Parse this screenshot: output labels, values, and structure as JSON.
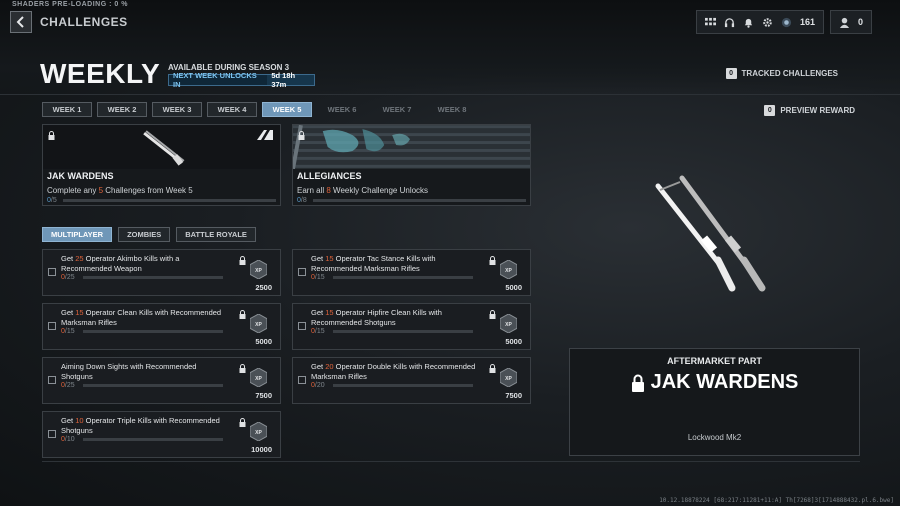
{
  "system": {
    "shaders": "SHADERS PRE-LOADING : 0 %",
    "build": "10.12.18878224 [68:217:11281+11:A] Th[7268]3[1714888432.pl.6.bwe]"
  },
  "header": {
    "breadcrumb": "CHALLENGES",
    "cod_points": "161",
    "tokens": "0"
  },
  "page": {
    "title": "WEEKLY",
    "availability": "AVAILABLE DURING SEASON 3",
    "next_week_label": "NEXT WEEK UNLOCKS IN",
    "next_week_time": "5d 18h 37m",
    "tracked_key": "0",
    "tracked_label": "TRACKED CHALLENGES",
    "preview_key": "0",
    "preview_label": "PREVIEW REWARD"
  },
  "weeks": [
    {
      "label": "WEEK 1",
      "state": "normal"
    },
    {
      "label": "WEEK 2",
      "state": "normal"
    },
    {
      "label": "WEEK 3",
      "state": "normal"
    },
    {
      "label": "WEEK 4",
      "state": "normal"
    },
    {
      "label": "WEEK 5",
      "state": "active"
    },
    {
      "label": "WEEK 6",
      "state": "locked"
    },
    {
      "label": "WEEK 7",
      "state": "locked"
    },
    {
      "label": "WEEK 8",
      "state": "locked"
    }
  ],
  "rewards": [
    {
      "name": "JAK WARDENS",
      "desc_pre": "Complete any ",
      "desc_num": "5",
      "desc_post": " Challenges from Week 5",
      "progress": "0",
      "total": "/5",
      "brand": "A"
    },
    {
      "name": "ALLEGIANCES",
      "desc_pre": "Earn all ",
      "desc_num": "8",
      "desc_post": " Weekly Challenge Unlocks",
      "progress": "0",
      "total": "/8"
    }
  ],
  "modes": [
    {
      "label": "MULTIPLAYER",
      "active": true
    },
    {
      "label": "ZOMBIES",
      "active": false
    },
    {
      "label": "BATTLE ROYALE",
      "active": false
    }
  ],
  "challenges": [
    {
      "pre": "Get ",
      "num": "25",
      "post": " Operator Akimbo Kills with a Recommended Weapon",
      "progress": "0",
      "total": "/25",
      "xp": "2500"
    },
    {
      "pre": "Get ",
      "num": "15",
      "post": " Operator Tac Stance Kills with Recommended Marksman Rifles",
      "progress": "0",
      "total": "/15",
      "xp": "5000"
    },
    {
      "pre": "Get ",
      "num": "15",
      "post": " Operator Clean Kills with Recommended Marksman Rifles",
      "progress": "0",
      "total": "/15",
      "xp": "5000"
    },
    {
      "pre": "Get ",
      "num": "15",
      "post": " Operator Hipfire Clean Kills with Recommended Shotguns",
      "progress": "0",
      "total": "/15",
      "xp": "5000"
    },
    {
      "pre": "Aiming Down Sights with Recommended Shotguns",
      "num": "",
      "post": "",
      "progress": "0",
      "total": "/25",
      "xp": "7500"
    },
    {
      "pre": "Get ",
      "num": "20",
      "post": " Operator Double Kills with Recommended Marksman Rifles",
      "progress": "0",
      "total": "/20",
      "xp": "7500"
    },
    {
      "pre": "Get ",
      "num": "10",
      "post": " Operator Triple Kills with Recommended Shotguns",
      "progress": "0",
      "total": "/10",
      "xp": "10000"
    }
  ],
  "preview": {
    "label": "AFTERMARKET PART",
    "name": "JAK WARDENS",
    "base": "Lockwood Mk2"
  },
  "colors": {
    "accent": "#6f97b8",
    "highlight": "#e0633a",
    "progress_num": "#5a9ccc"
  }
}
